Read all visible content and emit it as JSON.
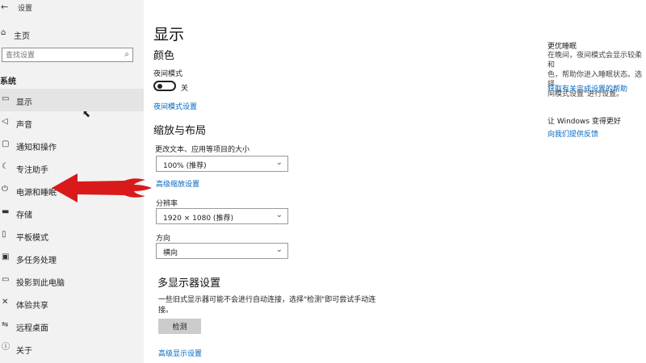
{
  "window": {
    "app_title": "设置",
    "back_glyph": "←"
  },
  "sidebar": {
    "home_label": "主页",
    "search_placeholder": "查找设置",
    "section_title": "系统",
    "items": [
      {
        "label": "显示",
        "icon": "monitor-icon",
        "active": true
      },
      {
        "label": "声音",
        "icon": "speaker-icon"
      },
      {
        "label": "通知和操作",
        "icon": "notification-icon"
      },
      {
        "label": "专注助手",
        "icon": "moon-icon"
      },
      {
        "label": "电源和睡眠",
        "icon": "power-icon"
      },
      {
        "label": "存储",
        "icon": "storage-icon"
      },
      {
        "label": "平板模式",
        "icon": "tablet-icon"
      },
      {
        "label": "多任务处理",
        "icon": "multitask-icon"
      },
      {
        "label": "投影到此电脑",
        "icon": "project-icon"
      },
      {
        "label": "体验共享",
        "icon": "share-icon"
      },
      {
        "label": "远程桌面",
        "icon": "remote-desktop-icon"
      },
      {
        "label": "关于",
        "icon": "info-icon"
      }
    ]
  },
  "main": {
    "title": "显示",
    "color_section": "颜色",
    "night_mode_label": "夜间模式",
    "night_mode_state": "关",
    "night_mode_link": "夜间模式设置",
    "scale_section": "缩放与布局",
    "scale_label": "更改文本、应用等项目的大小",
    "scale_value": "100% (推荐)",
    "advanced_scale_link": "高级缩放设置",
    "resolution_label": "分辨率",
    "resolution_value": "1920 × 1080 (推荐)",
    "orientation_label": "方向",
    "orientation_value": "横向",
    "multi_display_section": "多显示器设置",
    "multi_display_desc": "一些旧式显示器可能不会进行自动连接，选择\"检测\"即可尝试手动连接。",
    "detect_button": "检测",
    "advanced_display_link": "高级显示设置"
  },
  "right_panel": {
    "title": "更优睡眠",
    "body": "在晚间，夜间模式会显示较柔和\n色，帮助你进入睡眠状态。选择\n间模式设置\"进行设置。",
    "help_link": "获取有关完成设置的帮助",
    "improve_title": "让 Windows 变得更好",
    "feedback_link": "向我们提供反馈"
  },
  "colors": {
    "accent_link": "#0067c0",
    "annotation_arrow": "#d81a1a"
  }
}
